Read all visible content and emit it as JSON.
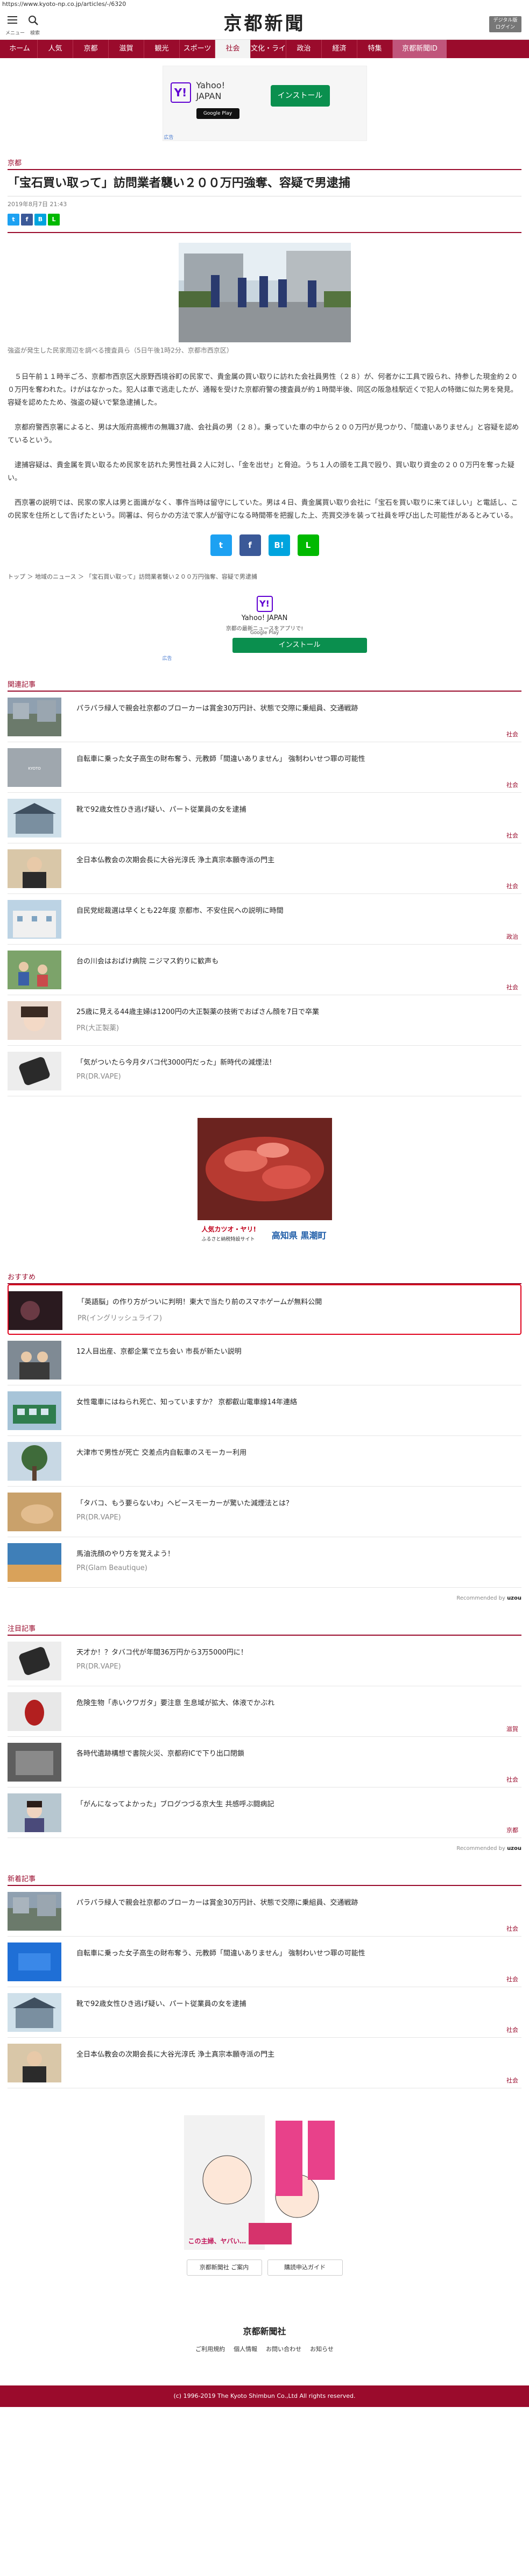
{
  "url": "https://www.kyoto-np.co.jp/articles/-/6320",
  "header": {
    "menu_label": "メニュー",
    "search_label": "検索",
    "logo": "京都新聞",
    "digital_line1": "デジタル版",
    "digital_line2": "ログイン"
  },
  "nav": [
    "ホーム",
    "人気",
    "京都",
    "滋賀",
    "観光",
    "スポーツ",
    "社会",
    "文化・ライフ",
    "政治",
    "経済",
    "特集",
    "京都新聞ID"
  ],
  "nav_active": 6,
  "ad_top": {
    "brand1": "Yahoo!",
    "brand2": "JAPAN",
    "store": "Google Play",
    "button": "インストール",
    "label": "広告"
  },
  "article": {
    "section": "京都",
    "title": "「宝石買い取って」訪問業者襲い２００万円強奪、容疑で男逮捕",
    "date": "2019年8月7日 21:43",
    "caption": "強盗が発生した民家周辺を調べる捜査員ら（5日午後1時2分、京都市西京区）",
    "paragraphs": [
      "５日午前１１時半ごろ、京都市西京区大原野西境谷町の民家で、貴金属の買い取りに訪れた会社員男性（２８）が、何者かに工具で殴られ、持参した現金約２００万円を奪われた。けがはなかった。犯人は車で逃走したが、通報を受けた京都府警の捜査員が約１時間半後、同区の阪急桂駅近くで犯人の特徴に似た男を発見。容疑を認めたため、強盗の疑いで緊急逮捕した。",
      "京都府警西京署によると、男は大阪府高槻市の無職37歳、会社員の男（２８）。乗っていた車の中から２００万円が見つかり、「間違いありません」と容疑を認めているという。",
      "逮捕容疑は、貴金属を買い取るため民家を訪れた男性社員２人に対し、「金を出せ」と脅迫。うち１人の頭を工具で殴り、買い取り資金の２００万円を奪った疑い。",
      "西京署の説明では、民家の家人は男と面識がなく、事件当時は留守にしていた。男は４日、貴金属買い取り会社に「宝石を買い取りに来てほしい」と電話し、この民家を住所として告げたという。同署は、何らかの方法で家人が留守になる時間帯を把握した上、売買交渉を装って社員を呼び出した可能性があるとみている。"
    ],
    "breadcrumb": "トップ ＞ 地域のニュース ＞ 「宝石買い取って」訪問業者襲い２００万円強奪、容疑で男逮捕"
  },
  "ad_mid": {
    "brand": "Yahoo! JAPAN",
    "line": "京都の最新ニュースをアプリで!",
    "store": "Google Play",
    "button": "インストール",
    "label": "広告"
  },
  "related_heading": "関連記事",
  "related": [
    {
      "title": "パラパラ緑人で親会社京都のブローカーは賞金30万円計、状態で交際に乗組員、交通戦跡",
      "cat": "社会",
      "thumb": "city"
    },
    {
      "title": "自転車に乗った女子高生の財布奪う、元教師「間違いありません」 強制わいせつ罪の可能性",
      "cat": "社会",
      "thumb": "gray"
    },
    {
      "title": "靴で92歳女性ひき逃げ疑い、パート従業員の女を逮捕",
      "cat": "社会",
      "thumb": "house"
    },
    {
      "title": "全日本仏教会の次期会長に大谷光淳氏 浄土真宗本願寺派の門主",
      "cat": "社会",
      "thumb": "monk"
    },
    {
      "title": "自民党総裁選は早くとも22年度 京都市、不安住民への説明に時間",
      "cat": "政治",
      "thumb": "building"
    },
    {
      "title": "台の川会はおばけ病院 ニジマス釣りに歓声も",
      "cat": "社会",
      "thumb": "people"
    },
    {
      "title": "25歳に見える44歳主婦は1200円の大正製薬の技術でおばさん顔を7日で卒業",
      "sub": "PR(大正製薬)",
      "cat": "",
      "thumb": "face"
    },
    {
      "title": "「気がついたら今月タバコ代3000円だった」新時代の減煙法!",
      "sub": "PR(DR.VAPE)",
      "cat": "",
      "thumb": "device"
    }
  ],
  "ad_fish": {
    "line1": "人気カツオ・ヤリ!",
    "line2": "ふるさと納税特設サイト",
    "place": "高知県 黒潮町"
  },
  "recommend_heading": "おすすめ",
  "recommend": [
    {
      "title": "「英語脳」の作り方がついに判明！東大で当たり前のスマホゲームが無料公開",
      "sub": "PR(イングリッシュライフ)",
      "thumb": "dark",
      "hl": true
    },
    {
      "title": "12人目出産、京都企業で立ち会い 市長が新たい説明",
      "sub": "",
      "thumb": "family"
    },
    {
      "title": "女性電車にはねられ死亡、知っていますか？ 京都叡山電車線14年連絡",
      "sub": "",
      "thumb": "train"
    },
    {
      "title": "大津市で男性が死亡 交差点内自転車のスモーカー利用",
      "sub": "",
      "thumb": "tree"
    },
    {
      "title": "「タバコ、もう要らないわ」ヘビースモーカーが驚いた減煙法とは？",
      "sub": "PR(DR.VAPE)",
      "thumb": "hand"
    },
    {
      "title": "馬油洗顔のやり方を覚えよう！",
      "sub": "PR(Glam Beautique)",
      "thumb": "sea"
    }
  ],
  "recommended_by": "Recommended by",
  "recommended_brand": "uzou",
  "attention_heading": "注目記事",
  "attention": [
    {
      "title": "天才か！？タバコ代が年間36万円から3万5000円に！",
      "sub": "PR(DR.VAPE)",
      "cat": "",
      "thumb": "device"
    },
    {
      "title": "危険生物「赤いクワガタ」要注意 生息域が拡大、体液でかぶれ",
      "sub": "",
      "cat": "滋賀",
      "thumb": "bug"
    },
    {
      "title": "各時代遺跡構想で書院火災、京都府ICで下り出口閉鎖",
      "sub": "",
      "cat": "社会",
      "thumb": "bw"
    },
    {
      "title": "「がんになってよかった」ブログつづる京大生 共感呼ぶ闘病記",
      "sub": "",
      "cat": "京都",
      "thumb": "girl"
    }
  ],
  "latest_heading": "新着記事",
  "latest": [
    {
      "title": "パラパラ緑人で親会社京都のブローカーは賞金30万円計、状態で交際に乗組員、交通戦跡",
      "cat": "社会",
      "thumb": "city"
    },
    {
      "title": "自転車に乗った女子高生の財布奪う、元教師「間違いありません」 強制わいせつ罪の可能性",
      "cat": "社会",
      "thumb": "blue"
    },
    {
      "title": "靴で92歳女性ひき逃げ疑い、パート従業員の女を逮捕",
      "cat": "社会",
      "thumb": "house"
    },
    {
      "title": "全日本仏教会の次期会長に大谷光淳氏 浄土真宗本願寺派の門主",
      "cat": "社会",
      "thumb": "monk"
    }
  ],
  "manga_ad": {
    "line": "この主婦、ヤバい…"
  },
  "footer": {
    "btn1": "京都新聞社 ご案内",
    "btn2": "購読申込ガイド",
    "logo": "京都新聞社",
    "links": [
      "ご利用規約",
      "個人情報",
      "お問い合わせ",
      "お知らせ"
    ],
    "copyright": "(c) 1996-2019 The Kyoto Shimbun Co.,Ltd All rights reserved."
  },
  "colors": {
    "brand": "#9a0b2c",
    "link": "#4a7bd0",
    "install": "#0a8f4e"
  }
}
